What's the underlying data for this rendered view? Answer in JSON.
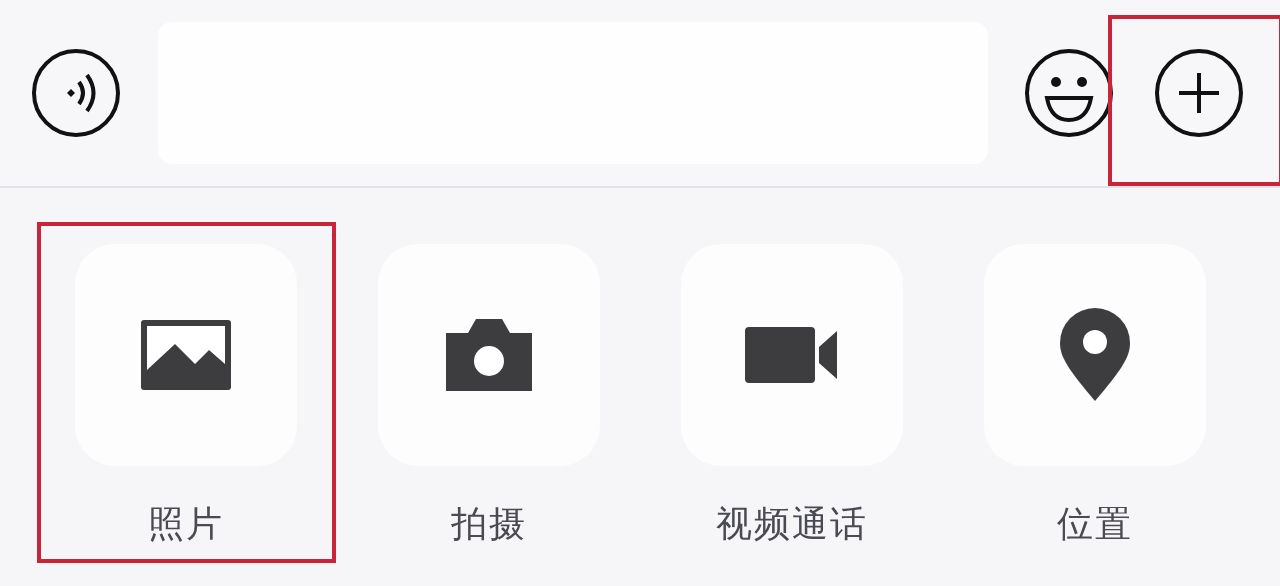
{
  "input_bar": {
    "buttons": [
      {
        "kind": "voice",
        "highlighted": false
      },
      {
        "kind": "emoji",
        "highlighted": false
      },
      {
        "kind": "more",
        "highlighted": true
      }
    ]
  },
  "actions": [
    {
      "kind": "photo",
      "label": "照片",
      "highlighted": true
    },
    {
      "kind": "camera",
      "label": "拍摄",
      "highlighted": false
    },
    {
      "kind": "video",
      "label": "视频通话",
      "highlighted": false
    },
    {
      "kind": "location",
      "label": "位置",
      "highlighted": false
    }
  ]
}
